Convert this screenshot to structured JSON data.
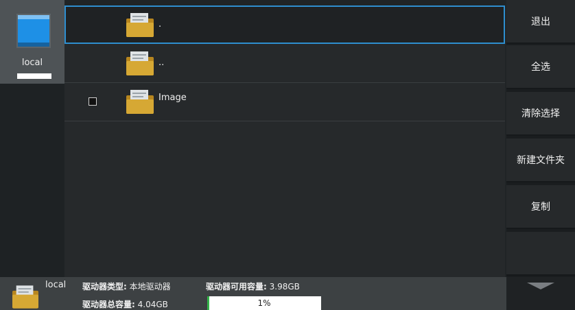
{
  "drive": {
    "label": "local"
  },
  "files": [
    {
      "name": ".",
      "selected": true,
      "checkbox": false
    },
    {
      "name": "..",
      "selected": false,
      "checkbox": false
    },
    {
      "name": "Image",
      "selected": false,
      "checkbox": true
    }
  ],
  "actions": {
    "exit": "退出",
    "select_all": "全选",
    "clear_selection": "清除选择",
    "new_folder": "新建文件夹",
    "copy": "复制"
  },
  "footer": {
    "drive_name": "local",
    "type_label": "驱动器类型:",
    "type_value": "本地驱动器",
    "free_label": "驱动器可用容量:",
    "free_value": "3.98GB",
    "total_label": "驱动器总容量:",
    "total_value": "4.04GB",
    "usage_percent": 1,
    "usage_text": "1%"
  },
  "colors": {
    "selection_border": "#2e8fd0",
    "drive_blue": "#1e90e6",
    "folder_gold": "#d6a834",
    "progress_green": "#34b24a"
  },
  "icons": [
    "drive-icon",
    "folder-icon",
    "chevron-down-icon"
  ]
}
